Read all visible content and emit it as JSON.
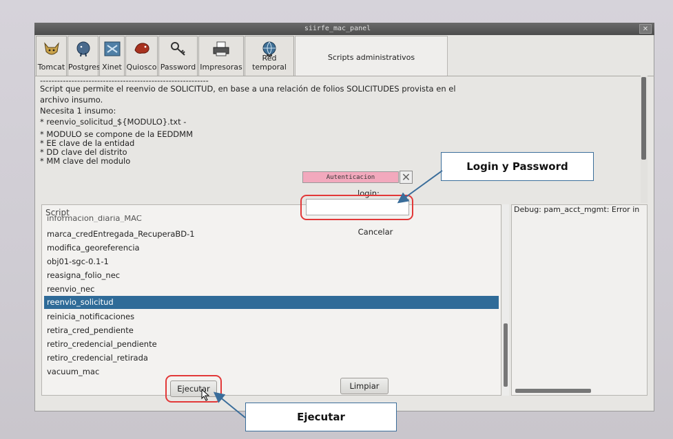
{
  "window": {
    "title": "siirfe_mac_panel",
    "close": "✕"
  },
  "tabs": [
    {
      "label": "Tomcat",
      "icon": "tomcat-icon"
    },
    {
      "label": "Postgres",
      "icon": "postgres-elephant-icon"
    },
    {
      "label": "Xinet",
      "icon": "xinet-icon"
    },
    {
      "label": "Quiosco",
      "icon": "quiosco-icon"
    },
    {
      "label": "Password",
      "icon": "key-icon"
    },
    {
      "label": "Impresoras",
      "icon": "printer-icon"
    },
    {
      "label": "Red temporal",
      "icon": "network-globe-icon"
    },
    {
      "label": "Scripts administrativos"
    }
  ],
  "description": {
    "separator": "-----------------------------------------------------------",
    "lines": [
      "Script que permite el reenvio de SOLICITUD, en base a una relación de folios SOLICITUDES provista en el",
      "archivo insumo.",
      "",
      "Necesita 1 insumo:",
      "",
      "* reenvio_solicitud_${MODULO}.txt -",
      "",
      "* MODULO se compone de la EEDDMM",
      "* EE clave de la entidad",
      "* DD clave del distrito",
      "* MM clave del modulo"
    ]
  },
  "script_list": {
    "header": "Script",
    "partial_item": "informacion_diaria_MAC",
    "items": [
      "marca_credEntregada_RecuperaBD-1",
      "modifica_georeferencia",
      "obj01-sgc-0.1-1",
      "reasigna_folio_nec",
      "reenvio_nec",
      "reenvio_solicitud",
      "reinicia_notificaciones",
      "retira_cred_pendiente",
      "retiro_credencial_pendiente",
      "retiro_credencial_retirada",
      "vacuum_mac"
    ],
    "selected": "reenvio_solicitud"
  },
  "debug": {
    "text": "Debug: pam_acct_mgmt: Error in"
  },
  "buttons": {
    "execute": "Ejecutar",
    "clear": "Limpiar"
  },
  "auth_dialog": {
    "title": "Autenticacion",
    "close": "✕",
    "login_label": "login:",
    "login_value": "",
    "cancel": "Cancelar"
  },
  "callouts": {
    "login": "Login y Password",
    "execute": "Ejecutar"
  },
  "colors": {
    "selection": "#2f6b98",
    "highlight_ring": "#e23838",
    "callout_border": "#3a6d9a",
    "dialog_title": "#f2a9bd"
  }
}
